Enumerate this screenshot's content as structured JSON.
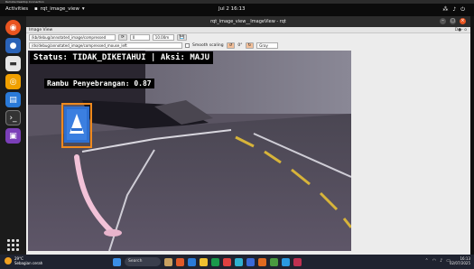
{
  "rdp": {
    "title": "Remote Desktop Connection"
  },
  "top_panel": {
    "activities": "Activities",
    "app_menu": "rqt_image_view",
    "clock": "Jul 2  16:13",
    "tray_icons": [
      "network-icon",
      "volume-icon",
      "power-icon"
    ]
  },
  "window": {
    "title": "rqt_image_view__ImageView - rqt",
    "plugin_title": "Image View",
    "plugin_right": "D●- o",
    "topic_select": "/kb/debug/annotated_image/compressed",
    "refresh_label": "⟳",
    "zoom_1": "0",
    "zoom_2": "10.00m",
    "save_label": "💾",
    "topic2": "/ds/debug/annotated_image/compressed_mouse_left",
    "smooth_label": "Smooth scaling",
    "rotate_label": "0°",
    "rotate_select": "Gray"
  },
  "overlay": {
    "status_text": "Status: TIDAK_DIKETAHUI | Aksi: MAJU",
    "detection_label": "Rambu Penyebrangan: 0.87"
  },
  "colors": {
    "bbox": "#f08a1e",
    "sign_blue": "#2e6fd0",
    "ubuntu_orange": "#e95420"
  },
  "taskbar": {
    "weather_temp": "29°C",
    "weather_desc": "Sebagian cerah",
    "search_placeholder": "Search",
    "time": "16:13",
    "date": "02/07/2025"
  }
}
